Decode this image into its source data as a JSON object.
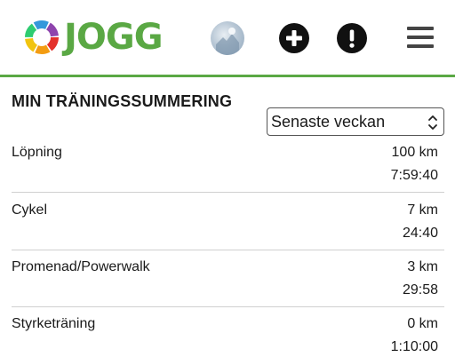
{
  "header": {
    "logo_text": "JOGG",
    "colors": {
      "brand_green": "#5aa844",
      "ring": [
        "#e4312b",
        "#f39c12",
        "#f1c40f",
        "#2ecc71",
        "#3498db",
        "#8e44ad"
      ]
    },
    "avatar_icon": "user-avatar",
    "add_icon": "plus-circle-icon",
    "alert_icon": "exclamation-circle-icon",
    "menu_icon": "hamburger-menu-icon"
  },
  "summary": {
    "title": "MIN TRÄNINGSSUMMERING",
    "period_select": {
      "selected": "Senaste veckan"
    },
    "rows": [
      {
        "name": "Löpning",
        "distance": "100 km",
        "time": "7:59:40"
      },
      {
        "name": "Cykel",
        "distance": "7 km",
        "time": "24:40"
      },
      {
        "name": "Promenad/Powerwalk",
        "distance": "3 km",
        "time": "29:58"
      },
      {
        "name": "Styrketräning",
        "distance": "0 km",
        "time": "1:10:00"
      }
    ]
  }
}
